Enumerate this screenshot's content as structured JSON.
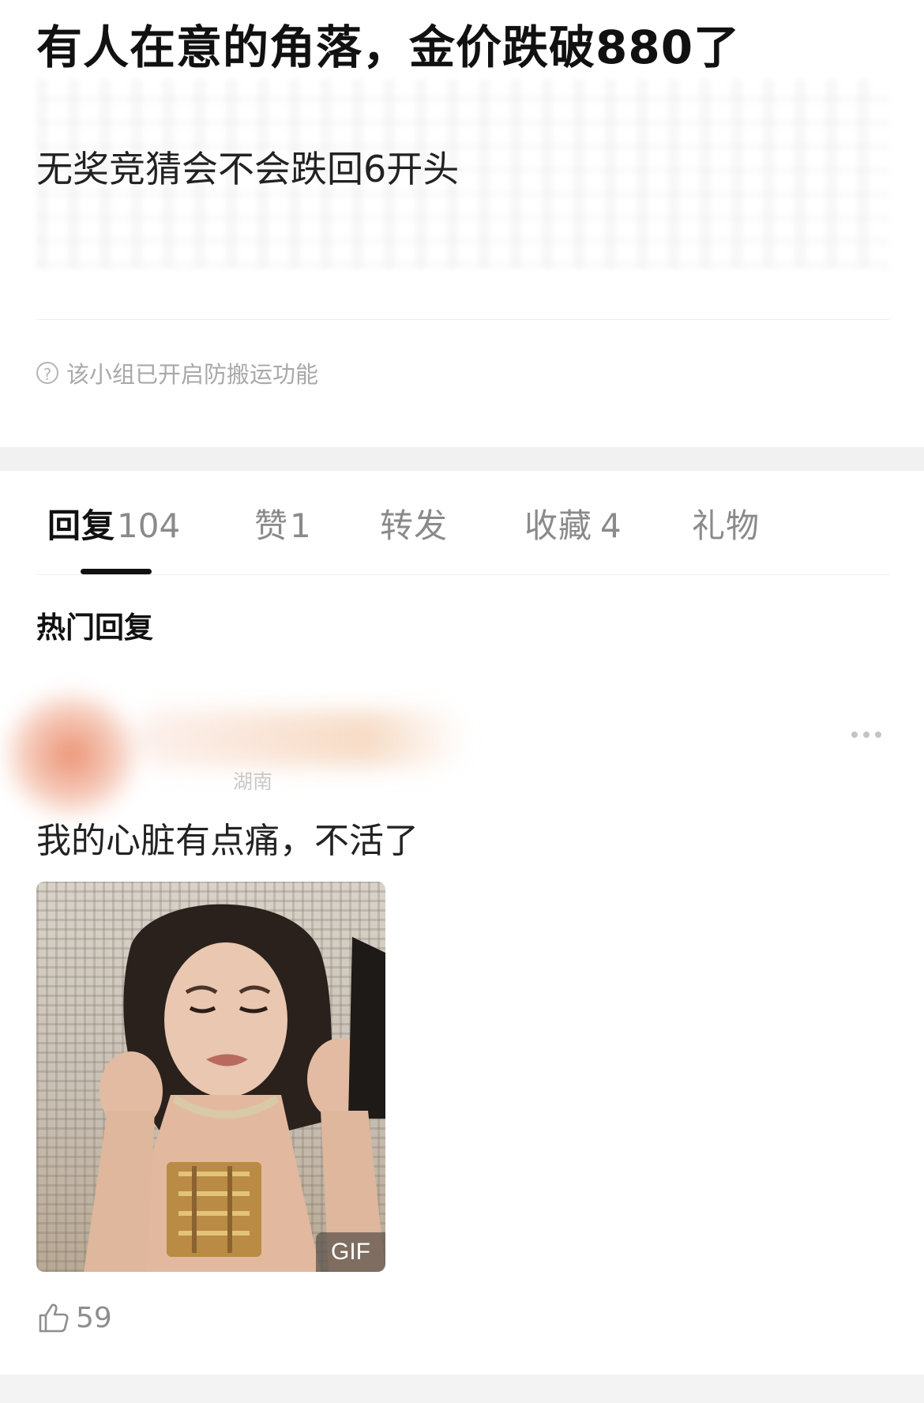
{
  "post": {
    "title": "有人在意的角落，金价跌破880了",
    "body": "无奖竞猜会不会跌回6开头",
    "notice": "该小组已开启防搬运功能"
  },
  "tabs": [
    {
      "label": "回复",
      "count": "104",
      "active": true
    },
    {
      "label": "赞",
      "count": "1",
      "active": false
    },
    {
      "label": "转发",
      "count": "",
      "active": false
    },
    {
      "label": "收藏",
      "count": "4",
      "active": false
    },
    {
      "label": "礼物",
      "count": "",
      "active": false
    }
  ],
  "hot_replies": {
    "title": "热门回复",
    "items": [
      {
        "user_meta": "湖南",
        "text": "我的心脏有点痛，不活了",
        "media_badge": "GIF",
        "likes": "59"
      }
    ]
  },
  "icons": {
    "help": "question-circle-icon",
    "more": "more-dots-icon",
    "like": "thumbs-up-icon"
  }
}
